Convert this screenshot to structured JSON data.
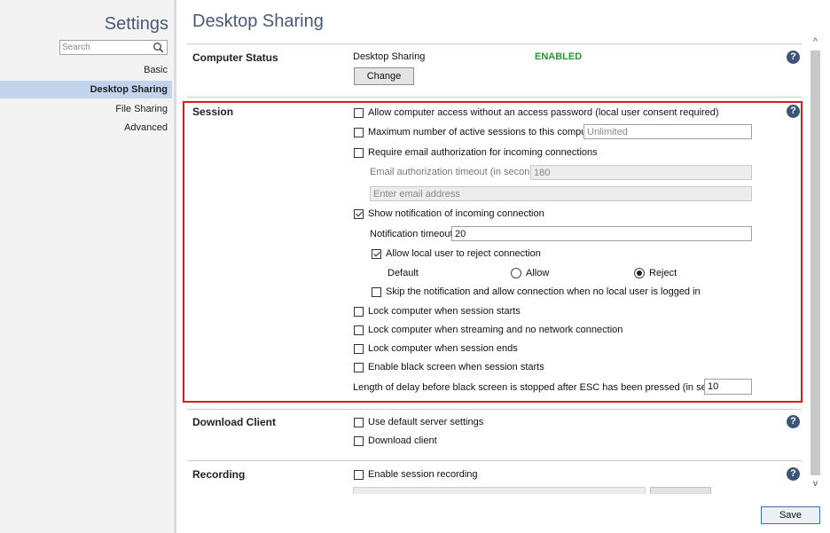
{
  "sidebar": {
    "title": "Settings",
    "search_placeholder": "Search",
    "items": [
      {
        "label": "Basic"
      },
      {
        "label": "Desktop Sharing"
      },
      {
        "label": "File Sharing"
      },
      {
        "label": "Advanced"
      }
    ]
  },
  "page": {
    "title": "Desktop Sharing"
  },
  "computer_status": {
    "title": "Computer Status",
    "label": "Desktop Sharing",
    "status": "ENABLED",
    "status_color": "#1f9a2c",
    "change_button": "Change"
  },
  "session": {
    "title": "Session",
    "allow_without_password": {
      "label": "Allow computer access without an access password (local user consent required)",
      "checked": false
    },
    "max_sessions": {
      "label": "Maximum number of active sessions to this computer",
      "checked": false,
      "placeholder": "Unlimited"
    },
    "require_email": {
      "label": "Require email authorization for incoming connections",
      "checked": false
    },
    "email_timeout": {
      "label": "Email authorization timeout (in seconds)",
      "value": "180"
    },
    "email_address": {
      "placeholder": "Enter email address"
    },
    "show_notification": {
      "label": "Show notification of incoming connection",
      "checked": true
    },
    "notification_timeout": {
      "label": "Notification timeout",
      "value": "20"
    },
    "allow_reject": {
      "label": "Allow local user to reject connection",
      "checked": true
    },
    "default": {
      "label": "Default",
      "allow_label": "Allow",
      "reject_label": "Reject",
      "selected": "Reject"
    },
    "skip_notification": {
      "label": "Skip the notification and allow connection when no local user is logged in",
      "checked": false
    },
    "lock_on_start": {
      "label": "Lock computer when session starts",
      "checked": false
    },
    "lock_streaming": {
      "label": "Lock computer when streaming and no network connection",
      "checked": false
    },
    "lock_on_end": {
      "label": "Lock computer when session ends",
      "checked": false
    },
    "black_screen": {
      "label": "Enable black screen when session starts",
      "checked": false
    },
    "delay": {
      "label": "Length of delay before black screen is stopped after ESC has been pressed (in seconds)",
      "value": "10"
    }
  },
  "download_client": {
    "title": "Download Client",
    "use_default": {
      "label": "Use default server settings",
      "checked": false
    },
    "download": {
      "label": "Download client",
      "checked": false
    }
  },
  "recording": {
    "title": "Recording",
    "enable": {
      "label": "Enable session recording",
      "checked": false
    }
  },
  "footer": {
    "save_button": "Save"
  },
  "icons": {
    "help": "?",
    "scroll_up": "^",
    "scroll_down": "v"
  },
  "colors": {
    "highlight": "#e01a1a",
    "active_nav": "#c2d4ec",
    "title": "#4a5a75"
  }
}
